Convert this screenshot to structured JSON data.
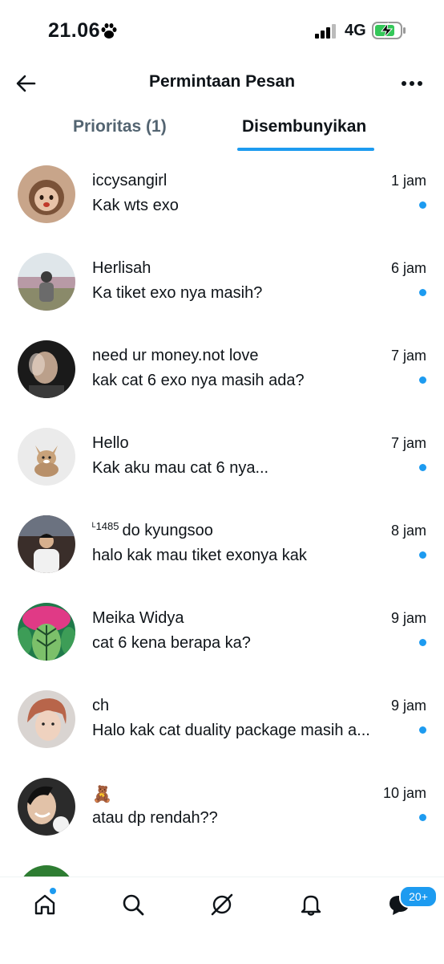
{
  "status_bar": {
    "time": "21.06",
    "network": "4G"
  },
  "header": {
    "title": "Permintaan Pesan"
  },
  "tabs": [
    {
      "label": "Prioritas (1)",
      "active": false
    },
    {
      "label": "Disembunyikan",
      "active": true
    }
  ],
  "messages": [
    {
      "name": "iccysangirl",
      "time": "1 jam",
      "preview": "Kak wts exo",
      "unread": true
    },
    {
      "name": "Herlisah",
      "time": "6 jam",
      "preview": "Ka tiket exo nya masih?",
      "unread": true
    },
    {
      "name": "need ur money.not love",
      "time": "7 jam",
      "preview": "kak cat 6 exo nya masih ada?",
      "unread": true
    },
    {
      "name": "Hello",
      "time": "7 jam",
      "preview": "Kak aku mau cat 6 nya...",
      "unread": true
    },
    {
      "name_prefix": "ᴸ1485",
      "name": "do kyungsoo",
      "time": "8 jam",
      "preview": "halo kak mau tiket exonya kak",
      "unread": true
    },
    {
      "name": "Meika Widya",
      "time": "9 jam",
      "preview": "cat 6 kena berapa ka?",
      "unread": true
    },
    {
      "name": "ch",
      "time": "9 jam",
      "preview": "Halo kak cat duality package masih a...",
      "unread": true
    },
    {
      "name": "🧸",
      "time": "10 jam",
      "preview": "atau dp rendah??",
      "unread": true
    }
  ],
  "bottom_nav": {
    "items": [
      "home-icon",
      "search-icon",
      "grok-icon",
      "notifications-icon",
      "messages-icon"
    ],
    "messages_badge": "20+"
  },
  "colors": {
    "accent": "#1d9bf0",
    "text": "#0f1419",
    "muted": "#536471"
  }
}
